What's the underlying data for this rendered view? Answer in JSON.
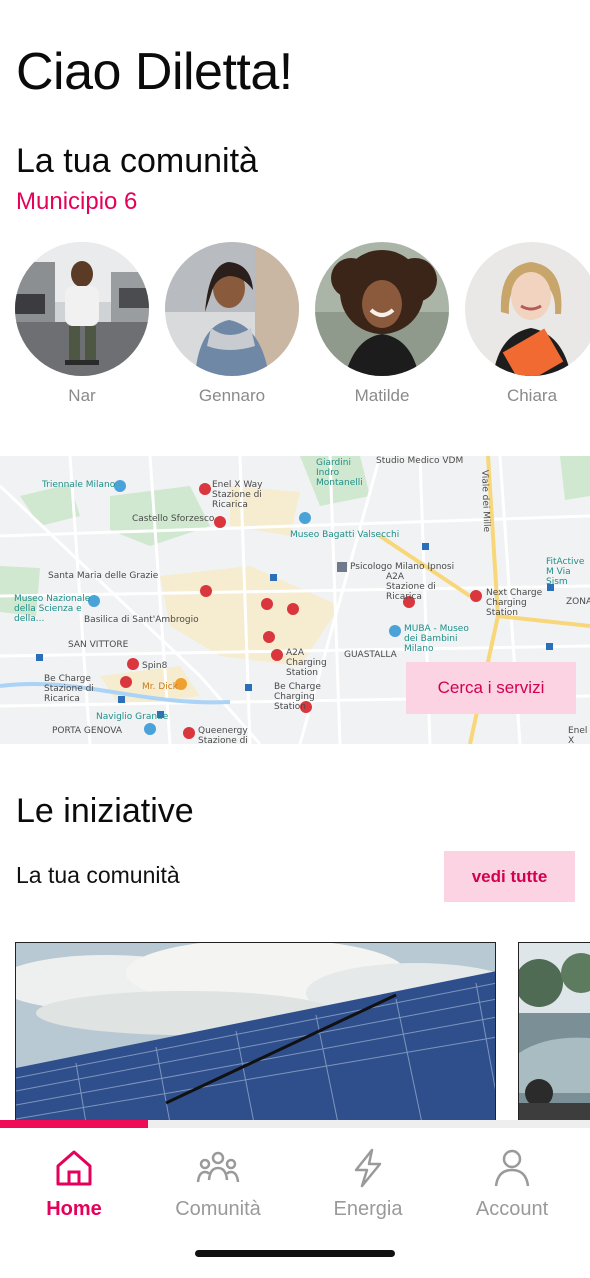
{
  "greeting": "Ciao Diletta!",
  "community": {
    "title": "La tua comunità",
    "district": "Municipio 6",
    "members": [
      {
        "name": "Nar"
      },
      {
        "name": "Gennaro"
      },
      {
        "name": "Matilde"
      },
      {
        "name": "Chiara"
      }
    ]
  },
  "map": {
    "button_label": "Cerca i servizi",
    "labels": [
      "Triennale Milano",
      "Castello Sforzesco",
      "Enel X Way Stazione di Ricarica",
      "Giardini Indro Montanelli",
      "Studio Medico VDM",
      "Museo Bagatti Valsecchi",
      "Santa Maria delle Grazie",
      "Psicologo Milano Ipnosi",
      "A2A Stazione di Ricarica",
      "Museo Nazionale della Scienza e della...",
      "Basilica di Sant'Ambrogio",
      "Next Charge Charging Station",
      "SAN VITTORE",
      "A2A Charging Station",
      "GUASTALLA",
      "MUBA - Museo dei Bambini Milano",
      "Spin8",
      "Be Charge Stazione di Ricarica",
      "Mr. Dick",
      "Be Charge Charging Station",
      "Naviglio Grande",
      "PORTA GENOVA",
      "Queenergy Stazione di Ricarica",
      "FitActive M Via Sism",
      "ZONA RE",
      "Enel X Stazio",
      "Viale dei Mille"
    ]
  },
  "initiatives": {
    "title": "Le iniziative",
    "subtitle": "La tua comunità",
    "see_all_label": "vedi tutte"
  },
  "progress": 0.25,
  "tabs": [
    {
      "label": "Home",
      "icon": "home-icon",
      "active": true
    },
    {
      "label": "Comunità",
      "icon": "community-icon",
      "active": false
    },
    {
      "label": "Energia",
      "icon": "energy-icon",
      "active": false
    },
    {
      "label": "Account",
      "icon": "account-icon",
      "active": false
    }
  ],
  "colors": {
    "accent": "#e5005a",
    "accent_light": "#fbd3e3",
    "inactive": "#9a9a9a"
  }
}
